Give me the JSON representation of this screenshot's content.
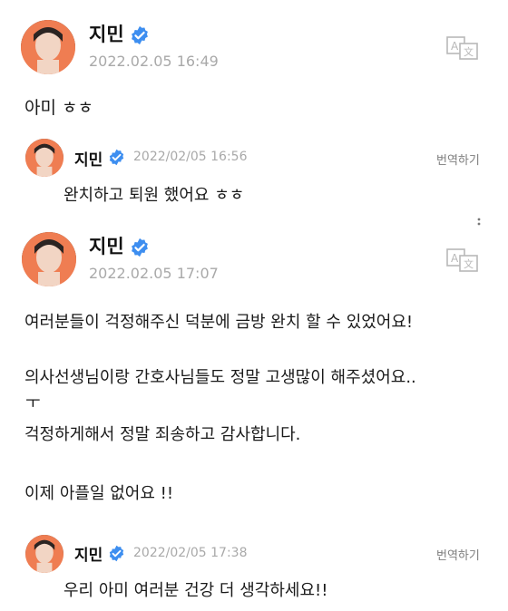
{
  "posts": [
    {
      "author": "지민",
      "date": "2022.02.05 16:49",
      "lines": [
        "아미 ㅎㅎ"
      ]
    },
    {
      "author": "지민",
      "date": "2022.02.05 17:07",
      "lines": [
        "여러분들이 걱정해주신 덕분에 금방 완치 할 수 있었어요!",
        "의사선생님이랑 간호사님들도 정말 고생많이 해주셨어요..",
        "ㅜ",
        "걱정하게해서 정말 죄송하고 감사합니다.",
        "이제 아플일 없어요 !!"
      ]
    }
  ],
  "comments": [
    {
      "author": "지민",
      "date": "2022/02/05 16:56",
      "translate_label": "번역하기",
      "text": "완치하고 퇴원 했어요 ㅎㅎ"
    },
    {
      "author": "지민",
      "date": "2022/02/05 17:38",
      "translate_label": "번역하기",
      "text": "우리 아미 여러분 건강 더 생각하세요!!"
    }
  ],
  "icons": {
    "verified": "verified-badge-icon",
    "translate": "translate-icon",
    "more": "more-vertical-icon"
  },
  "colors": {
    "verified": "#3d8ef0",
    "date": "#a9a9a9",
    "avatar_bg": "#ef7d52"
  }
}
